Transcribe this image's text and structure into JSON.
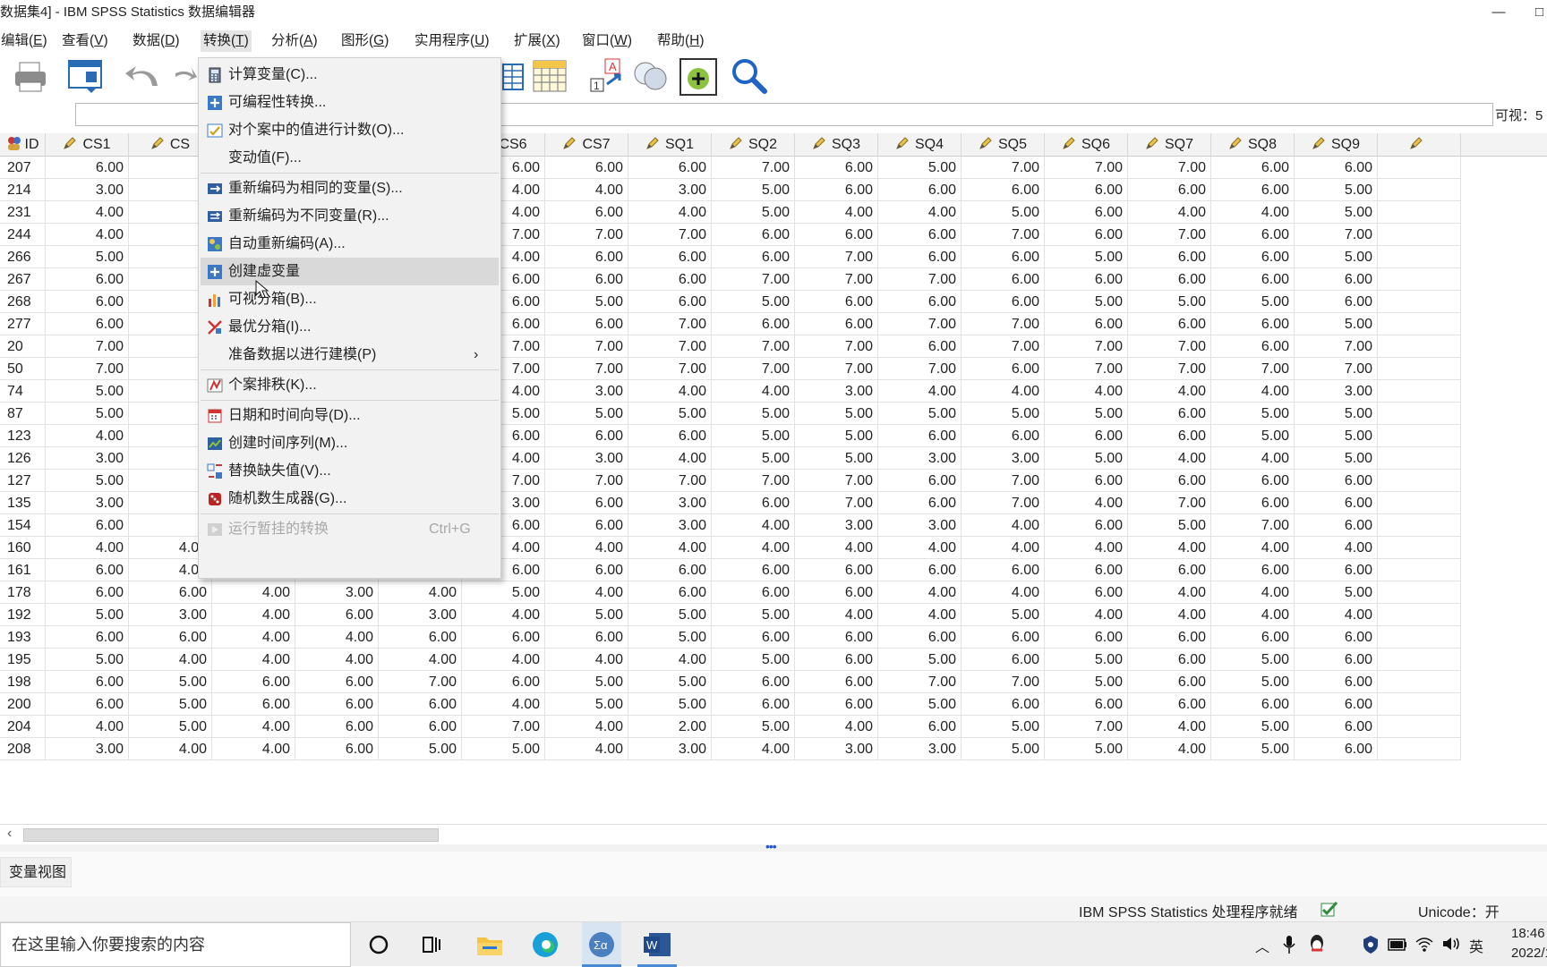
{
  "window": {
    "title": "数据集4] - IBM SPSS Statistics 数据编辑器",
    "minimize": "—",
    "maximize": "□"
  },
  "menubar": [
    {
      "label": "编辑(E)",
      "u": "E"
    },
    {
      "label": "查看(V)",
      "u": "V"
    },
    {
      "label": "数据(D)",
      "u": "D"
    },
    {
      "label": "转换(T)",
      "u": "T"
    },
    {
      "label": "分析(A)",
      "u": "A"
    },
    {
      "label": "图形(G)",
      "u": "G"
    },
    {
      "label": "实用程序(U)",
      "u": "U"
    },
    {
      "label": "扩展(X)",
      "u": "X"
    },
    {
      "label": "窗口(W)",
      "u": "W"
    },
    {
      "label": "帮助(H)",
      "u": "H"
    }
  ],
  "cellbar": {
    "visible_label": "可视：5"
  },
  "transform_menu": [
    {
      "label": "计算变量(C)...",
      "icon": "calculator-icon"
    },
    {
      "label": "可编程性转换...",
      "icon": "plus-icon"
    },
    {
      "label": "对个案中的值进行计数(O)...",
      "icon": "count-icon"
    },
    {
      "label": "变动值(F)...",
      "icon": ""
    },
    {
      "sep": true
    },
    {
      "label": "重新编码为相同的变量(S)...",
      "icon": "recode-same-icon"
    },
    {
      "label": "重新编码为不同变量(R)...",
      "icon": "recode-different-icon"
    },
    {
      "label": "自动重新编码(A)...",
      "icon": "auto-recode-icon"
    },
    {
      "label": "创建虚变量",
      "icon": "plus-icon",
      "highlighted": true
    },
    {
      "label": "可视分箱(B)...",
      "icon": "visual-binning-icon"
    },
    {
      "label": "最优分箱(I)...",
      "icon": "optimal-binning-icon"
    },
    {
      "label": "准备数据以进行建模(P)",
      "icon": "",
      "submenu": "›"
    },
    {
      "sep": true
    },
    {
      "label": "个案排秩(K)...",
      "icon": "rank-cases-icon"
    },
    {
      "sep": true
    },
    {
      "label": "日期和时间向导(D)...",
      "icon": "date-wizard-icon"
    },
    {
      "label": "创建时间序列(M)...",
      "icon": "time-series-icon"
    },
    {
      "label": "替换缺失值(V)...",
      "icon": "missing-values-icon"
    },
    {
      "label": "随机数生成器(G)...",
      "icon": "dice-icon"
    },
    {
      "sep": true
    },
    {
      "label": "运行暂挂的转换",
      "icon": "run-pending-icon",
      "shortcut": "Ctrl+G",
      "disabled": true
    }
  ],
  "columns": [
    "ID",
    "CS1",
    "CS",
    "",
    "",
    "",
    "CS6",
    "CS7",
    "SQ1",
    "SQ2",
    "SQ3",
    "SQ4",
    "SQ5",
    "SQ6",
    "SQ7",
    "SQ8",
    "SQ9",
    ""
  ],
  "rows": [
    [
      "207",
      "6.00",
      "",
      "",
      "",
      "",
      "6.00",
      "6.00",
      "6.00",
      "7.00",
      "6.00",
      "5.00",
      "7.00",
      "7.00",
      "7.00",
      "6.00",
      "6.00"
    ],
    [
      "214",
      "3.00",
      "",
      "",
      "",
      "",
      "4.00",
      "4.00",
      "3.00",
      "5.00",
      "6.00",
      "6.00",
      "6.00",
      "6.00",
      "6.00",
      "6.00",
      "5.00"
    ],
    [
      "231",
      "4.00",
      "",
      "",
      "",
      "",
      "4.00",
      "6.00",
      "4.00",
      "5.00",
      "4.00",
      "4.00",
      "5.00",
      "6.00",
      "4.00",
      "4.00",
      "5.00"
    ],
    [
      "244",
      "4.00",
      "",
      "",
      "",
      "",
      "7.00",
      "7.00",
      "7.00",
      "6.00",
      "6.00",
      "6.00",
      "7.00",
      "6.00",
      "7.00",
      "6.00",
      "7.00"
    ],
    [
      "266",
      "5.00",
      "",
      "",
      "",
      "",
      "4.00",
      "6.00",
      "6.00",
      "6.00",
      "7.00",
      "6.00",
      "6.00",
      "5.00",
      "6.00",
      "6.00",
      "5.00"
    ],
    [
      "267",
      "6.00",
      "",
      "",
      "",
      "",
      "6.00",
      "6.00",
      "6.00",
      "7.00",
      "7.00",
      "7.00",
      "6.00",
      "6.00",
      "6.00",
      "6.00",
      "6.00"
    ],
    [
      "268",
      "6.00",
      "",
      "",
      "",
      "",
      "6.00",
      "5.00",
      "6.00",
      "5.00",
      "6.00",
      "6.00",
      "6.00",
      "5.00",
      "5.00",
      "5.00",
      "6.00"
    ],
    [
      "277",
      "6.00",
      "",
      "",
      "",
      "",
      "6.00",
      "6.00",
      "7.00",
      "6.00",
      "6.00",
      "7.00",
      "7.00",
      "6.00",
      "6.00",
      "6.00",
      "5.00"
    ],
    [
      "20",
      "7.00",
      "",
      "",
      "",
      "",
      "7.00",
      "7.00",
      "7.00",
      "7.00",
      "7.00",
      "6.00",
      "7.00",
      "7.00",
      "7.00",
      "6.00",
      "7.00"
    ],
    [
      "50",
      "7.00",
      "",
      "",
      "",
      "",
      "7.00",
      "7.00",
      "7.00",
      "7.00",
      "7.00",
      "7.00",
      "6.00",
      "7.00",
      "7.00",
      "7.00",
      "7.00"
    ],
    [
      "74",
      "5.00",
      "",
      "",
      "",
      "",
      "4.00",
      "3.00",
      "4.00",
      "4.00",
      "3.00",
      "4.00",
      "4.00",
      "4.00",
      "4.00",
      "4.00",
      "3.00"
    ],
    [
      "87",
      "5.00",
      "",
      "",
      "",
      "",
      "5.00",
      "5.00",
      "5.00",
      "5.00",
      "5.00",
      "5.00",
      "5.00",
      "5.00",
      "6.00",
      "5.00",
      "5.00"
    ],
    [
      "123",
      "4.00",
      "",
      "",
      "",
      "",
      "6.00",
      "6.00",
      "6.00",
      "5.00",
      "5.00",
      "6.00",
      "6.00",
      "6.00",
      "6.00",
      "5.00",
      "5.00"
    ],
    [
      "126",
      "3.00",
      "",
      "",
      "",
      "",
      "4.00",
      "3.00",
      "4.00",
      "5.00",
      "5.00",
      "3.00",
      "3.00",
      "5.00",
      "4.00",
      "4.00",
      "5.00"
    ],
    [
      "127",
      "5.00",
      "",
      "",
      "",
      "",
      "7.00",
      "7.00",
      "7.00",
      "7.00",
      "7.00",
      "6.00",
      "7.00",
      "6.00",
      "6.00",
      "6.00",
      "6.00"
    ],
    [
      "135",
      "3.00",
      "",
      "",
      "",
      "",
      "3.00",
      "6.00",
      "3.00",
      "6.00",
      "7.00",
      "6.00",
      "7.00",
      "4.00",
      "7.00",
      "6.00",
      "6.00"
    ],
    [
      "154",
      "6.00",
      "",
      "",
      "",
      "",
      "6.00",
      "6.00",
      "3.00",
      "4.00",
      "3.00",
      "3.00",
      "4.00",
      "6.00",
      "5.00",
      "7.00",
      "6.00"
    ],
    [
      "160",
      "4.00",
      "4.00",
      "4.00",
      "4.00",
      "4.00",
      "4.00",
      "4.00",
      "4.00",
      "4.00",
      "4.00",
      "4.00",
      "4.00",
      "4.00",
      "4.00",
      "4.00",
      "4.00"
    ],
    [
      "161",
      "6.00",
      "4.00",
      "6.00",
      "6.00",
      "6.00",
      "6.00",
      "6.00",
      "6.00",
      "6.00",
      "6.00",
      "6.00",
      "6.00",
      "6.00",
      "6.00",
      "6.00",
      "6.00"
    ],
    [
      "178",
      "6.00",
      "6.00",
      "4.00",
      "3.00",
      "4.00",
      "5.00",
      "4.00",
      "6.00",
      "6.00",
      "6.00",
      "4.00",
      "4.00",
      "6.00",
      "4.00",
      "4.00",
      "5.00"
    ],
    [
      "192",
      "5.00",
      "3.00",
      "4.00",
      "6.00",
      "3.00",
      "4.00",
      "5.00",
      "5.00",
      "5.00",
      "4.00",
      "4.00",
      "5.00",
      "4.00",
      "4.00",
      "4.00",
      "4.00"
    ],
    [
      "193",
      "6.00",
      "6.00",
      "4.00",
      "4.00",
      "6.00",
      "6.00",
      "6.00",
      "5.00",
      "6.00",
      "6.00",
      "6.00",
      "6.00",
      "6.00",
      "6.00",
      "6.00",
      "6.00"
    ],
    [
      "195",
      "5.00",
      "4.00",
      "4.00",
      "4.00",
      "4.00",
      "4.00",
      "4.00",
      "4.00",
      "5.00",
      "6.00",
      "5.00",
      "6.00",
      "5.00",
      "6.00",
      "5.00",
      "6.00"
    ],
    [
      "198",
      "6.00",
      "5.00",
      "6.00",
      "6.00",
      "7.00",
      "6.00",
      "5.00",
      "5.00",
      "6.00",
      "6.00",
      "7.00",
      "7.00",
      "5.00",
      "6.00",
      "5.00",
      "6.00"
    ],
    [
      "200",
      "6.00",
      "5.00",
      "6.00",
      "6.00",
      "6.00",
      "4.00",
      "5.00",
      "5.00",
      "6.00",
      "6.00",
      "5.00",
      "6.00",
      "6.00",
      "6.00",
      "6.00",
      "6.00"
    ],
    [
      "204",
      "4.00",
      "5.00",
      "4.00",
      "6.00",
      "6.00",
      "7.00",
      "4.00",
      "2.00",
      "5.00",
      "4.00",
      "6.00",
      "5.00",
      "7.00",
      "4.00",
      "5.00",
      "6.00"
    ],
    [
      "208",
      "3.00",
      "4.00",
      "4.00",
      "6.00",
      "5.00",
      "5.00",
      "4.00",
      "3.00",
      "4.00",
      "3.00",
      "3.00",
      "5.00",
      "5.00",
      "4.00",
      "5.00",
      "6.00"
    ]
  ],
  "view_tab": "变量视图",
  "status": {
    "processor": "IBM SPSS Statistics 处理程序就绪",
    "unicode": "Unicode：开"
  },
  "taskbar": {
    "search_placeholder": "在这里输入你要搜索的内容",
    "ime": "英",
    "time": "18:46",
    "date": "2022/1/"
  }
}
